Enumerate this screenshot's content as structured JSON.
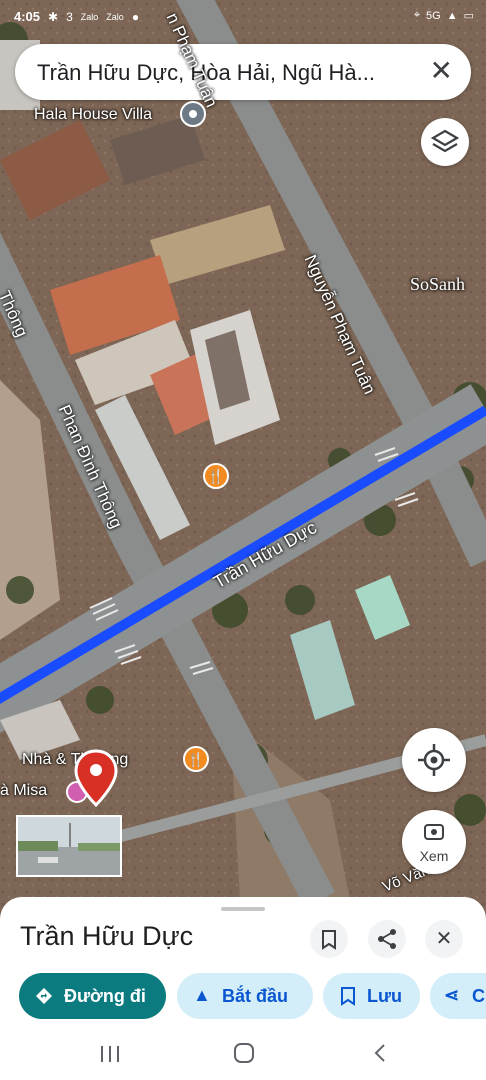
{
  "status_bar": {
    "time": "4:05",
    "icons": [
      "bluetooth-icon",
      "3-icon",
      "zalo-icon",
      "zalo-icon",
      "dot-icon"
    ],
    "right_icons": [
      "location-icon",
      "5g-signal-icon",
      "battery-icon"
    ],
    "zalo_label": "Zalo",
    "network": "5G"
  },
  "search": {
    "text": "Trần Hữu Dực, Hòa Hải, Ngũ Hà...",
    "close_icon": "close-icon"
  },
  "map": {
    "layers_icon": "layers-icon",
    "watermark": "SoSanh",
    "roads": [
      {
        "name": "Trần Hữu Dực"
      },
      {
        "name": "Nguyễn Phạm Tuân"
      },
      {
        "name": "Phan Đình Thông"
      },
      {
        "name": "Thông"
      },
      {
        "name": "Võ Văn"
      },
      {
        "name": "Nguyễn Phạm Tuân (top)",
        "label": "n Phạm Tuân"
      }
    ],
    "places": [
      {
        "name": "Hala House Villa"
      },
      {
        "name": "Nhà & ... Thương",
        "label": "Nhà & Thương"
      },
      {
        "name": "Nhà Misa",
        "label": "à Misa"
      }
    ],
    "restaurant_icon": "restaurant-icon",
    "pin_icon": "map-pin-icon",
    "locate_icon": "my-location-icon",
    "street_view": {
      "label": "Xem",
      "icon": "street-view-icon"
    }
  },
  "sheet": {
    "title": "Trần Hữu Dực",
    "save_icon": "bookmark-icon",
    "share_icon": "share-icon",
    "close_icon": "close-icon",
    "chips": [
      {
        "label": "Đường đi",
        "icon": "directions-icon"
      },
      {
        "label": "Bắt đầu",
        "icon": "navigation-arrow-icon"
      },
      {
        "label": "Lưu",
        "icon": "bookmark-icon"
      },
      {
        "label": "C",
        "icon": "share-icon"
      }
    ]
  },
  "nav": {
    "recent": "recent-apps-icon",
    "home": "home-icon",
    "back": "back-icon"
  },
  "colors": {
    "route_blue": "#1a4cff",
    "primary_chip": "#0b7b7f",
    "chip_bg": "#d3eef8",
    "pin_red": "#d93025",
    "restaurant_orange": "#f28b20"
  }
}
